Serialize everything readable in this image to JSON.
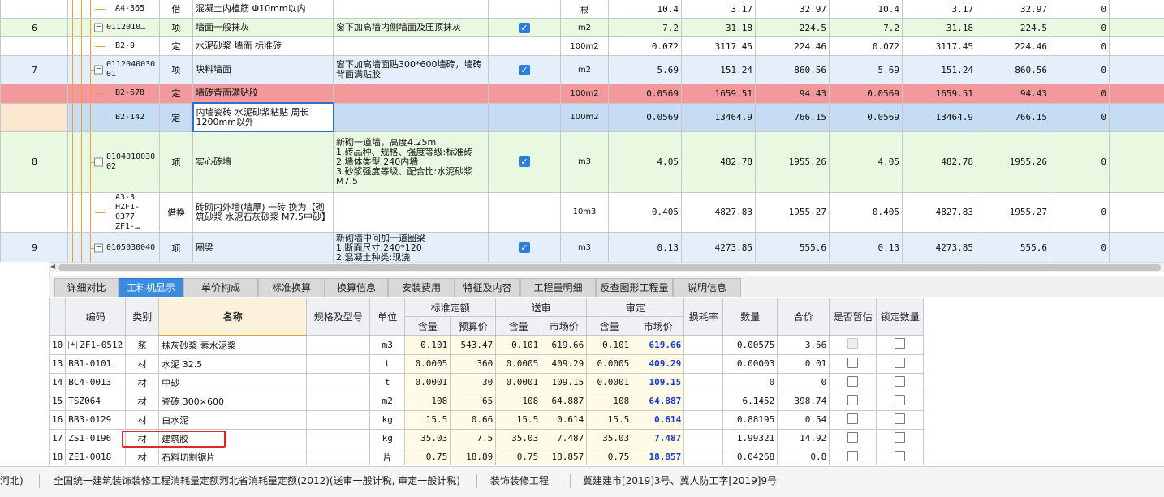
{
  "top_rows": [
    {
      "idx": "",
      "code": "A4-365",
      "type": "借",
      "name": "混凝土内植筋 Φ10mm以内",
      "feature": "",
      "check": "",
      "unit": "根",
      "qty": "10.4",
      "price": "3.17",
      "total": "32.97",
      "qty2": "10.4",
      "price2": "3.17",
      "total2": "32.97",
      "c1": "0",
      "c2": "0",
      "style": "quota"
    },
    {
      "idx": "6",
      "code": "0112010…",
      "type": "项",
      "name": "墙面一般抹灰",
      "feature": "窗下加高墙内侧墙面及压顶抹灰",
      "check": "✓",
      "unit": "m2",
      "qty": "7.2",
      "price": "31.18",
      "total": "224.5",
      "qty2": "7.2",
      "price2": "31.18",
      "total2": "224.5",
      "c1": "0",
      "c2": "0",
      "style": "item-green"
    },
    {
      "idx": "",
      "code": "B2-9",
      "type": "定",
      "name": "水泥砂浆 墙面 标准砖",
      "feature": "",
      "check": "",
      "unit": "100m2",
      "qty": "0.072",
      "price": "3117.45",
      "total": "224.46",
      "qty2": "0.072",
      "price2": "3117.45",
      "total2": "224.46",
      "c1": "0",
      "c2": "0",
      "style": "quota"
    },
    {
      "idx": "7",
      "code": "0112040030 01",
      "type": "项",
      "name": "块料墙面",
      "feature": "窗下加高墙面贴300*600墙砖，墙砖背面满贴胶",
      "check": "✓",
      "unit": "m2",
      "qty": "5.69",
      "price": "151.24",
      "total": "860.56",
      "qty2": "5.69",
      "price2": "151.24",
      "total2": "860.56",
      "c1": "0",
      "c2": "0",
      "style": "item-blue"
    },
    {
      "idx": "",
      "code": "B2-678",
      "type": "定",
      "name": "墙砖背面满贴胶",
      "feature": "",
      "check": "",
      "unit": "100m2",
      "qty": "0.0569",
      "price": "1659.51",
      "total": "94.43",
      "qty2": "0.0569",
      "price2": "1659.51",
      "total2": "94.43",
      "c1": "0",
      "c2": "0",
      "style": "red"
    },
    {
      "idx": "",
      "code": "B2-142",
      "type": "定",
      "name": "内墙瓷砖 水泥砂浆粘贴 周长1200mm以外",
      "feature": "",
      "check": "",
      "unit": "100m2",
      "qty": "0.0569",
      "price": "13464.9",
      "total": "766.15",
      "qty2": "0.0569",
      "price2": "13464.9",
      "total2": "766.15",
      "c1": "0",
      "c2": "0",
      "style": "selected"
    },
    {
      "idx": "8",
      "code": "0104010030 02",
      "type": "项",
      "name": "实心砖墙",
      "feature": "新砌一道墙，高度4.25m\n1.砖品种、规格、强度等级:标准砖\n2.墙体类型:240内墙\n3.砂浆强度等级、配合比:水泥砂浆M7.5",
      "check": "✓",
      "unit": "m3",
      "qty": "4.05",
      "price": "482.78",
      "total": "1955.26",
      "qty2": "4.05",
      "price2": "482.78",
      "total2": "1955.26",
      "c1": "0",
      "c2": "0",
      "style": "item-green"
    },
    {
      "idx": "",
      "code": "A3-3 HZF1-0377 ZF1-…",
      "type": "借换",
      "name": "砖砌内外墙(墙厚) 一砖 换为【砌筑砂浆 水泥石灰砂浆 M7.5中砂】",
      "feature": "",
      "check": "",
      "unit": "10m3",
      "qty": "0.405",
      "price": "4827.83",
      "total": "1955.27",
      "qty2": "0.405",
      "price2": "4827.83",
      "total2": "1955.27",
      "c1": "0",
      "c2": "0",
      "style": "quota"
    },
    {
      "idx": "9",
      "code": "0105030040",
      "type": "项",
      "name": "圈梁",
      "feature": "新砌墙中间加一道圈梁\n1.断面尺寸:240*120\n2.混凝土种类:现浇",
      "check": "✓",
      "unit": "m3",
      "qty": "0.13",
      "price": "4273.85",
      "total": "555.6",
      "qty2": "0.13",
      "price2": "4273.85",
      "total2": "555.6",
      "c1": "0",
      "c2": "0",
      "style": "item-blue"
    }
  ],
  "tabs": [
    "详细对比",
    "工料机显示",
    "单价构成",
    "标准换算",
    "换算信息",
    "安装费用",
    "特征及内容",
    "工程量明细",
    "反查图形工程量",
    "说明信息"
  ],
  "active_tab_index": 1,
  "bottom_headers": {
    "code": "编码",
    "cat": "类别",
    "name": "名称",
    "spec": "规格及型号",
    "unit": "单位",
    "std": "标准定额",
    "send": "送审",
    "audit": "审定",
    "sub_hl": "含量",
    "sub_budget": "预算价",
    "sub_market": "市场价",
    "loss": "损耗率",
    "count": "数量",
    "sum": "合价",
    "provisional": "是否暂估",
    "lock": "锁定数量"
  },
  "bottom_rows": [
    {
      "no": "10",
      "code": "ZF1-0512",
      "expand": true,
      "cat": "浆",
      "name": "抹灰砂浆 素水泥浆",
      "unit": "m3",
      "h1": "0.101",
      "p1": "543.47",
      "h2": "0.101",
      "p2": "619.66",
      "h3": "0.101",
      "p3": "619.66",
      "loss": "",
      "count": "0.00575",
      "sum": "3.56",
      "prov": "gray",
      "lock": "white"
    },
    {
      "no": "13",
      "code": "BB1-0101",
      "expand": false,
      "cat": "材",
      "name": "水泥 32.5",
      "unit": "t",
      "h1": "0.0005",
      "p1": "360",
      "h2": "0.0005",
      "p2": "409.29",
      "h3": "0.0005",
      "p3": "409.29",
      "loss": "",
      "count": "0.00003",
      "sum": "0.01",
      "prov": "white",
      "lock": "white"
    },
    {
      "no": "14",
      "code": "BC4-0013",
      "expand": false,
      "cat": "材",
      "name": "中砂",
      "unit": "t",
      "h1": "0.0001",
      "p1": "30",
      "h2": "0.0001",
      "p2": "109.15",
      "h3": "0.0001",
      "p3": "109.15",
      "loss": "",
      "count": "0",
      "sum": "0",
      "prov": "white",
      "lock": "white"
    },
    {
      "no": "15",
      "code": "TSZ064",
      "expand": false,
      "cat": "材",
      "name": "瓷砖 300×600",
      "unit": "m2",
      "h1": "108",
      "p1": "65",
      "h2": "108",
      "p2": "64.887",
      "h3": "108",
      "p3": "64.887",
      "loss": "",
      "count": "6.1452",
      "sum": "398.74",
      "prov": "white",
      "lock": "white"
    },
    {
      "no": "16",
      "code": "BB3-0129",
      "expand": false,
      "cat": "材",
      "name": "白水泥",
      "unit": "kg",
      "h1": "15.5",
      "p1": "0.66",
      "h2": "15.5",
      "p2": "0.614",
      "h3": "15.5",
      "p3": "0.614",
      "loss": "",
      "count": "0.88195",
      "sum": "0.54",
      "prov": "white",
      "lock": "white"
    },
    {
      "no": "17",
      "code": "ZS1-0196",
      "expand": false,
      "cat": "材",
      "name": "建筑胶",
      "unit": "kg",
      "h1": "35.03",
      "p1": "7.5",
      "h2": "35.03",
      "p2": "7.487",
      "h3": "35.03",
      "p3": "7.487",
      "loss": "",
      "count": "1.99321",
      "sum": "14.92",
      "prov": "white",
      "lock": "white"
    },
    {
      "no": "18",
      "code": "ZE1-0018",
      "expand": false,
      "cat": "材",
      "name": "石料切割锯片",
      "unit": "片",
      "h1": "0.75",
      "p1": "18.89",
      "h2": "0.75",
      "p2": "18.857",
      "h3": "0.75",
      "p3": "18.857",
      "loss": "",
      "count": "0.04268",
      "sum": "0.8",
      "prov": "white",
      "lock": "white"
    }
  ],
  "status": {
    "region": "河北)",
    "quota": "全国统一建筑装饰装修工程消耗量定额河北省消耗量定额(2012)(送审一般计税, 审定一般计税)",
    "profession": "装饰装修工程",
    "doc": "冀建建市[2019]3号、冀人防工字[2019]9号"
  },
  "colors": {
    "active_tab": "#3a8be0",
    "red_row": "#f3999c",
    "selected_row": "#c6dcf3",
    "green_row": "#e9f8e1",
    "blue_row": "#e5effb",
    "highlight_outline": "#e2262a",
    "price_blue": "#1b39c7"
  }
}
